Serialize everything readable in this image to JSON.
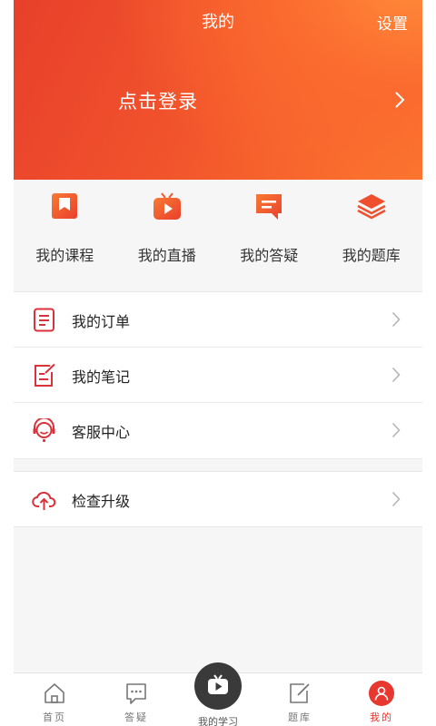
{
  "header": {
    "title": "我的",
    "settings_label": "设置",
    "login_label": "点击登录"
  },
  "colors": {
    "brand_red": "#e8352d",
    "brand_orange": "#f15a2b",
    "tab_center_bg": "#3a3a3a"
  },
  "quick_grid": [
    {
      "label": "我的课程",
      "icon": "bookmark-book-icon"
    },
    {
      "label": "我的直播",
      "icon": "tv-play-icon"
    },
    {
      "label": "我的答疑",
      "icon": "chat-bubble-icon"
    },
    {
      "label": "我的题库",
      "icon": "layers-stack-icon"
    }
  ],
  "menu_group_1": [
    {
      "label": "我的订单",
      "icon": "order-document-icon"
    },
    {
      "label": "我的笔记",
      "icon": "note-edit-icon"
    },
    {
      "label": "客服中心",
      "icon": "customer-service-icon"
    }
  ],
  "menu_group_2": [
    {
      "label": "检查升级",
      "icon": "cloud-upload-icon"
    }
  ],
  "tabbar": [
    {
      "label": "首页",
      "icon": "home-icon"
    },
    {
      "label": "答疑",
      "icon": "chat-icon"
    },
    {
      "label": "我的学习",
      "icon": "tv-play-icon"
    },
    {
      "label": "题库",
      "icon": "edit-icon"
    },
    {
      "label": "我的",
      "icon": "user-icon",
      "active": true
    }
  ]
}
